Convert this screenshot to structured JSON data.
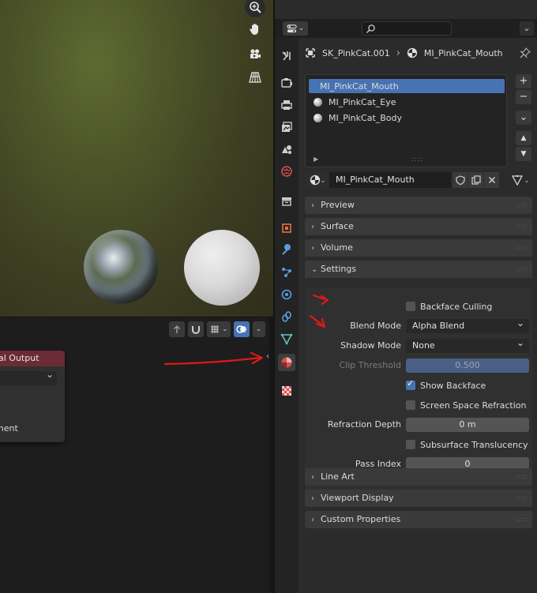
{
  "viewport": {
    "icons": [
      "zoom-icon",
      "hand-pan-icon",
      "camera-icon",
      "perspective-grid-icon"
    ]
  },
  "node_editor": {
    "node_title": "al Output",
    "node_socket": "ment"
  },
  "properties": {
    "breadcrumb": {
      "object": "SK_PinkCat.001",
      "separator": "›",
      "material": "MI_PinkCat_Mouth"
    },
    "material_slots": [
      {
        "label": "MI_PinkCat_Mouth",
        "selected": true
      },
      {
        "label": "MI_PinkCat_Eye",
        "selected": false
      },
      {
        "label": "MI_PinkCat_Body",
        "selected": false
      }
    ],
    "slot_buttons": {
      "add": "+",
      "remove": "−",
      "menu": "⌄",
      "up": "▲",
      "down": "▼"
    },
    "material_name": "MI_PinkCat_Mouth",
    "panels": {
      "preview": "Preview",
      "surface": "Surface",
      "volume": "Volume",
      "settings": "Settings",
      "line_art": "Line Art",
      "viewport_display": "Viewport Display",
      "custom_properties": "Custom Properties"
    },
    "settings": {
      "backface_culling": {
        "label": "Backface Culling",
        "checked": false
      },
      "blend_mode": {
        "label": "Blend Mode",
        "value": "Alpha Blend"
      },
      "shadow_mode": {
        "label": "Shadow Mode",
        "value": "None"
      },
      "clip_threshold": {
        "label": "Clip Threshold",
        "value": "0.500"
      },
      "show_backface": {
        "label": "Show Backface",
        "checked": true
      },
      "ssr": {
        "label": "Screen Space Refraction",
        "checked": false
      },
      "refraction_depth": {
        "label": "Refraction Depth",
        "value": "0 m"
      },
      "subsurface": {
        "label": "Subsurface Translucency",
        "checked": false
      },
      "pass_index": {
        "label": "Pass Index",
        "value": "0"
      }
    }
  },
  "colors": {
    "accent": "#4772b3",
    "annotation": "#e01818",
    "panel_bg": "#2b2b2b",
    "header_bg": "#3a3a3a"
  }
}
